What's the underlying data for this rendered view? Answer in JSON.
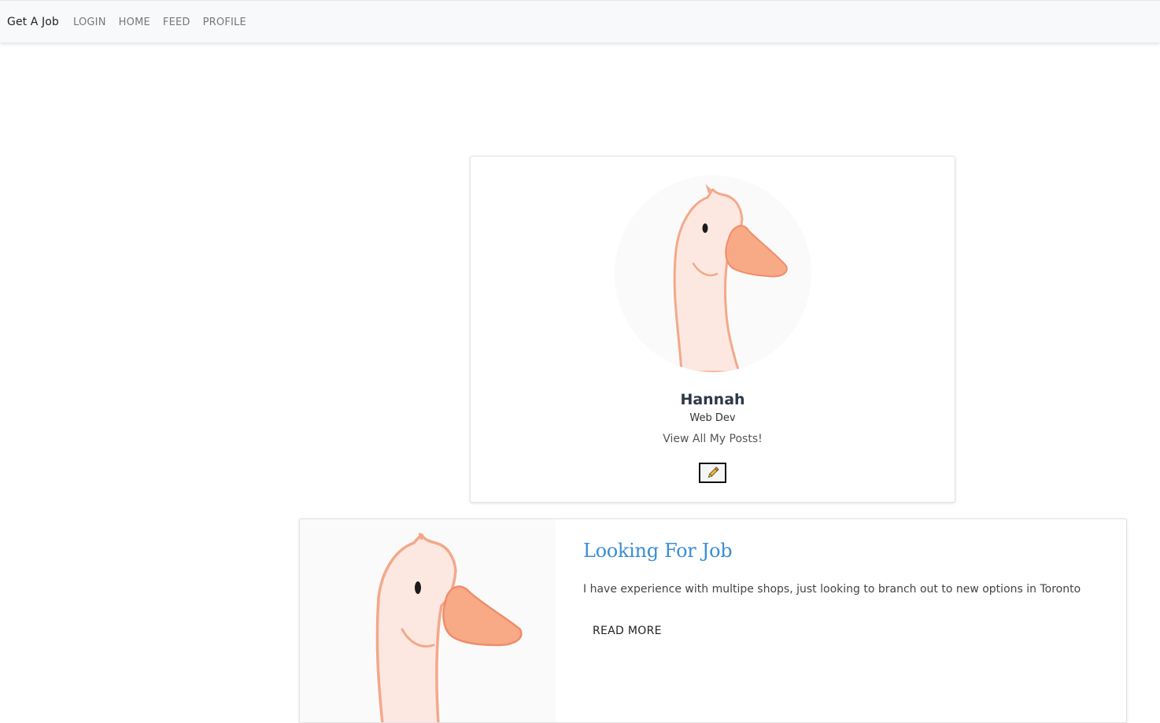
{
  "navbar": {
    "brand": "Get A Job",
    "links": [
      "LOGIN",
      "HOME",
      "FEED",
      "PROFILE"
    ]
  },
  "profile": {
    "avatar_icon": "goose-avatar",
    "name": "Hannah",
    "role": "Web Dev",
    "posts_link": "View All My Posts!",
    "edit_icon": "pencil-icon"
  },
  "post": {
    "image_icon": "goose-image",
    "title": "Looking For Job",
    "body": "I have experience with multipe shops, just looking to branch out to new options in Toronto",
    "read_more": "READ MORE"
  },
  "colors": {
    "navbar_bg": "#f8f9fa",
    "title_blue": "#3a8fd6",
    "goose_body": "#fde4dc",
    "goose_beak": "#f8aa86"
  }
}
